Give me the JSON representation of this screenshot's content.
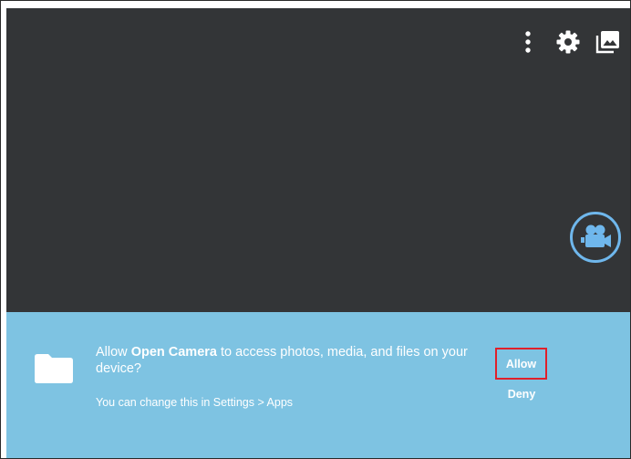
{
  "toolbar": {
    "icons": [
      "more-vert-icon",
      "settings-gear-icon",
      "gallery-icon"
    ]
  },
  "camera": {
    "video_mode_icon": "video-camera-icon",
    "accent_color": "#6fb7ec"
  },
  "dialog": {
    "icon": "folder-icon",
    "message_prefix": "Allow ",
    "app_name": "Open Camera",
    "message_suffix": " to access photos, media, and files on your device?",
    "sub_text": "You can change this in Settings > Apps",
    "allow_label": "Allow",
    "deny_label": "Deny",
    "background_color": "#7ec3e2"
  }
}
